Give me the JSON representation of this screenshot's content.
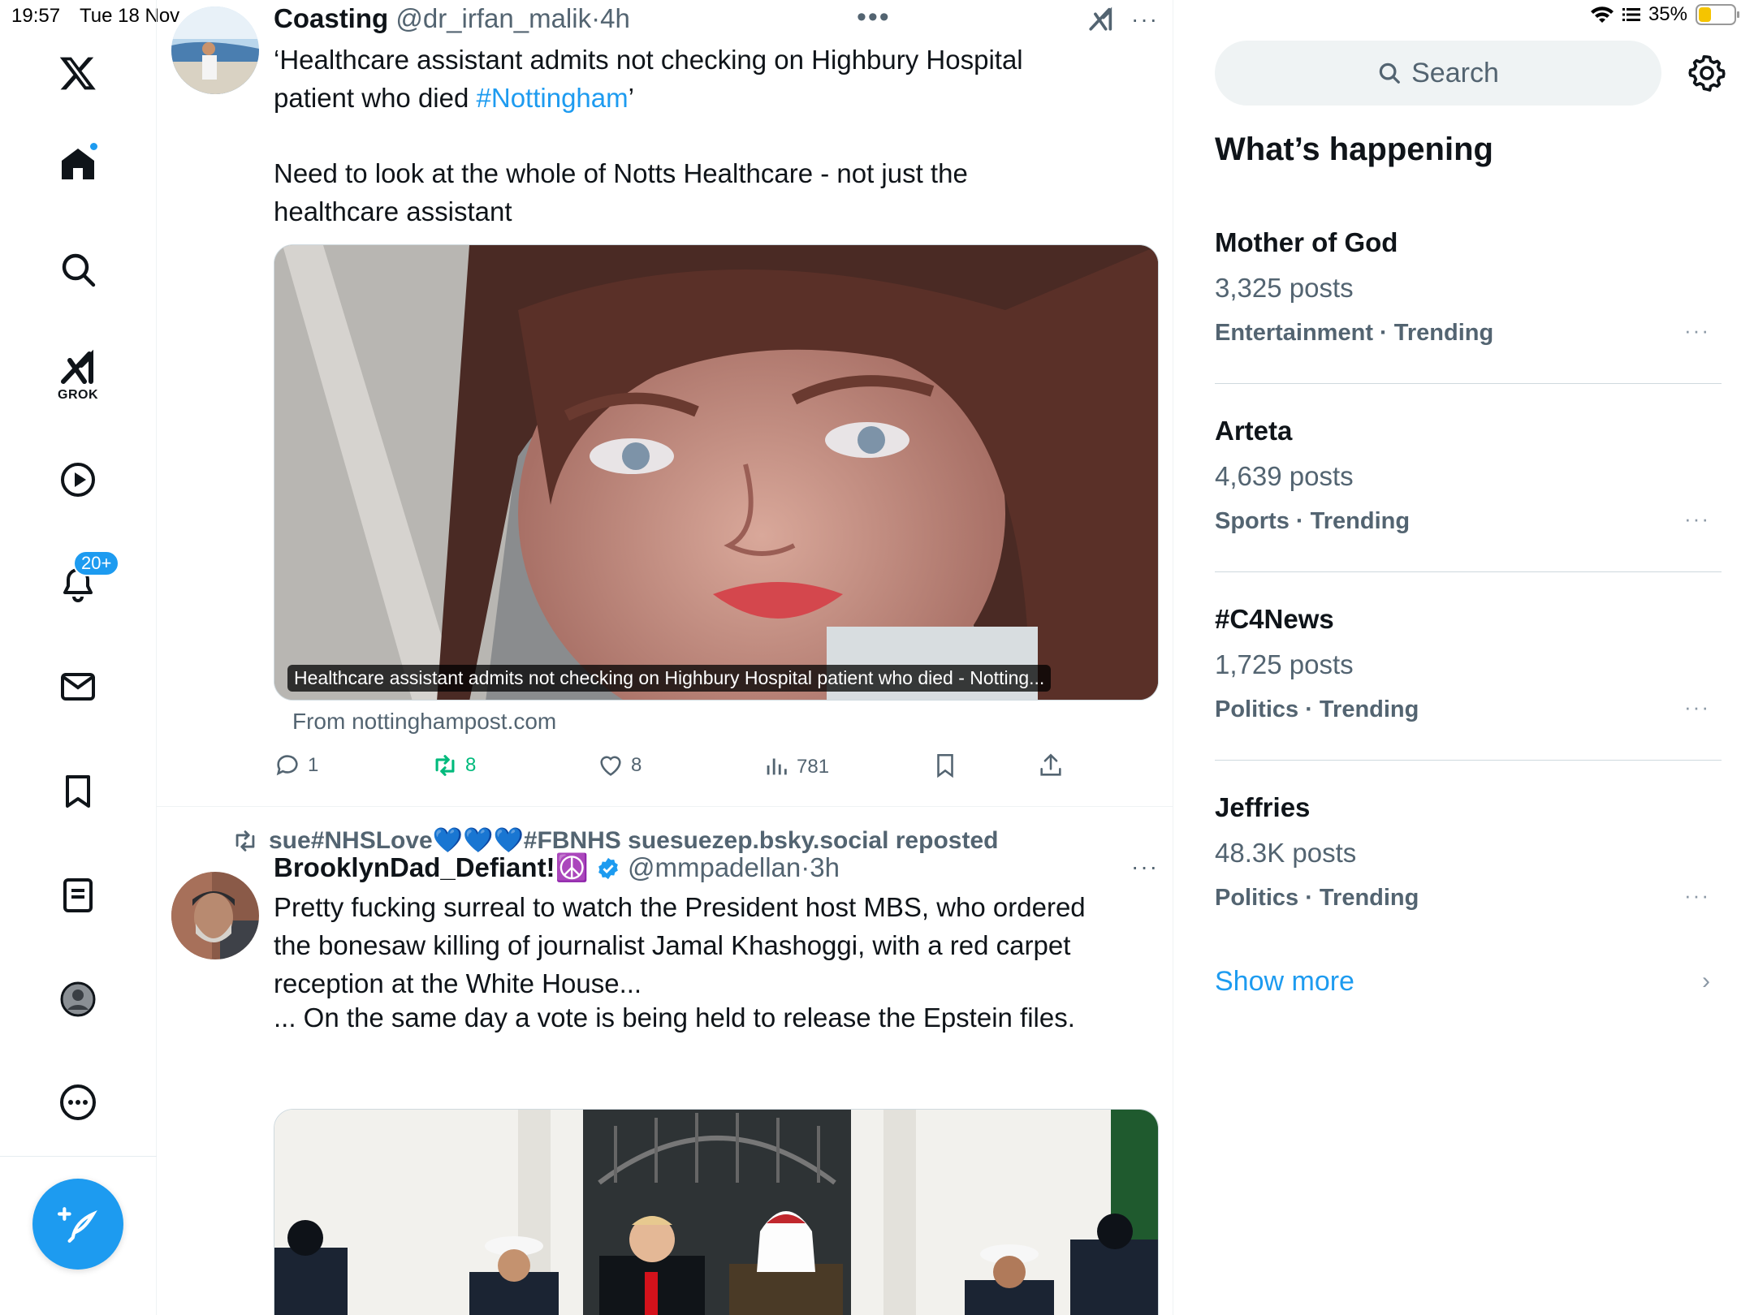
{
  "status": {
    "time": "19:57",
    "date": "Tue 18 Nov",
    "battery": "35%",
    "battery_level": 0.35
  },
  "nav": {
    "items": [
      "X",
      "Home",
      "Search",
      "Grok",
      "Videos",
      "Notifications",
      "Messages",
      "Bookmarks",
      "Lists",
      "Profile",
      "More"
    ],
    "grok_label": "GROK",
    "notifications_badge": "20+"
  },
  "tweets": [
    {
      "name": "Coasting",
      "handle": "@dr_irfan_malik",
      "time": "4h",
      "text_line1": "‘Healthcare assistant admits not checking on Highbury Hospital patient who died ",
      "hashtag": "#Nottingham",
      "text_line1_end": "’",
      "text_para2": "Need to look at the whole of Notts Healthcare - not just the healthcare assistant",
      "media_caption": "Healthcare assistant admits not checking on Highbury Hospital patient who died - Notting...",
      "from": "From nottinghampost.com",
      "replies": "1",
      "reposts": "8",
      "likes": "8",
      "views": "781"
    },
    {
      "reposted_by": "sue#NHSLove💙💙💙#FBNHS suesuezep.bsky.social reposted",
      "name": "BrooklynDad_Defiant!☮️",
      "handle": "@mmpadellan",
      "time": "3h",
      "text_para1": "Pretty fucking surreal to watch the President host MBS, who ordered the bonesaw killing of journalist Jamal Khashoggi, with a red carpet reception at the White House...",
      "text_para2": "... On the same day a vote is being held to release the Epstein files."
    }
  ],
  "right": {
    "search_placeholder": "Search",
    "whats_happening": "What’s happening",
    "trends": [
      {
        "name": "Mother of God",
        "count": "3,325 posts",
        "meta": "Entertainment · Trending"
      },
      {
        "name": "Arteta",
        "count": "4,639 posts",
        "meta": "Sports · Trending"
      },
      {
        "name": "#C4News",
        "count": "1,725 posts",
        "meta": "Politics · Trending"
      },
      {
        "name": "Jeffries",
        "count": "48.3K posts",
        "meta": "Politics · Trending"
      }
    ],
    "show_more": "Show more"
  },
  "colors": {
    "accent": "#1d9bf0",
    "repost_green": "#00ba7c",
    "text_secondary": "#536471"
  }
}
